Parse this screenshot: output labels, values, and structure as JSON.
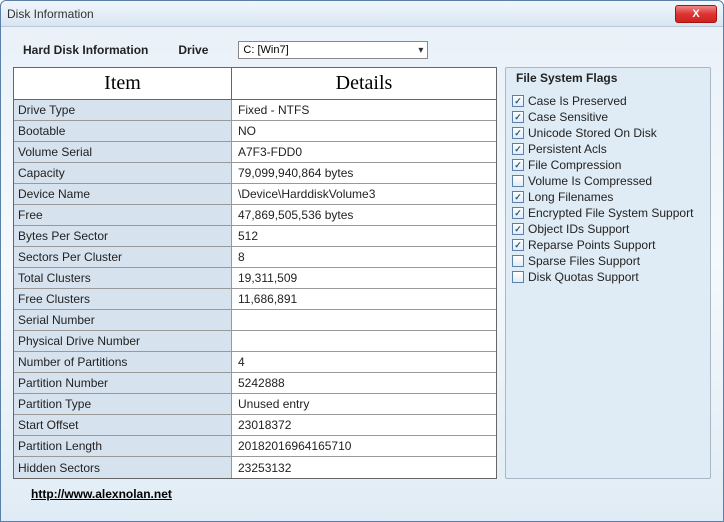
{
  "title": "Disk Information",
  "header": {
    "hard_disk_label": "Hard Disk Information",
    "drive_label": "Drive",
    "drive_selected": "C: [Win7]"
  },
  "table": {
    "col_item": "Item",
    "col_details": "Details",
    "rows": [
      {
        "item": "Drive Type",
        "details": "Fixed - NTFS"
      },
      {
        "item": "Bootable",
        "details": "NO"
      },
      {
        "item": "Volume Serial",
        "details": "A7F3-FDD0"
      },
      {
        "item": "Capacity",
        "details": "79,099,940,864 bytes"
      },
      {
        "item": "Device Name",
        "details": "\\Device\\HarddiskVolume3"
      },
      {
        "item": "Free",
        "details": "47,869,505,536 bytes"
      },
      {
        "item": "Bytes Per Sector",
        "details": "512"
      },
      {
        "item": "Sectors Per Cluster",
        "details": "8"
      },
      {
        "item": "Total Clusters",
        "details": "19,311,509"
      },
      {
        "item": "Free Clusters",
        "details": "11,686,891"
      },
      {
        "item": "Serial Number",
        "details": ""
      },
      {
        "item": "Physical Drive Number",
        "details": ""
      },
      {
        "item": "Number of Partitions",
        "details": "4"
      },
      {
        "item": "Partition Number",
        "details": "5242888"
      },
      {
        "item": "Partition Type",
        "details": "Unused entry"
      },
      {
        "item": "Start Offset",
        "details": "23018372"
      },
      {
        "item": "Partition Length",
        "details": "20182016964165710"
      },
      {
        "item": "Hidden Sectors",
        "details": "23253132"
      }
    ]
  },
  "flags": {
    "title": "File System Flags",
    "items": [
      {
        "label": "Case Is Preserved",
        "checked": true
      },
      {
        "label": "Case Sensitive",
        "checked": true
      },
      {
        "label": "Unicode Stored On Disk",
        "checked": true
      },
      {
        "label": "Persistent Acls",
        "checked": true
      },
      {
        "label": "File Compression",
        "checked": true
      },
      {
        "label": "Volume Is Compressed",
        "checked": false
      },
      {
        "label": "Long Filenames",
        "checked": true
      },
      {
        "label": "Encrypted File System Support",
        "checked": true
      },
      {
        "label": "Object IDs Support",
        "checked": true
      },
      {
        "label": "Reparse Points Support",
        "checked": true
      },
      {
        "label": "Sparse Files Support",
        "checked": false
      },
      {
        "label": "Disk Quotas Support",
        "checked": false
      }
    ]
  },
  "footer": {
    "link_text": "http://www.alexnolan.net"
  }
}
